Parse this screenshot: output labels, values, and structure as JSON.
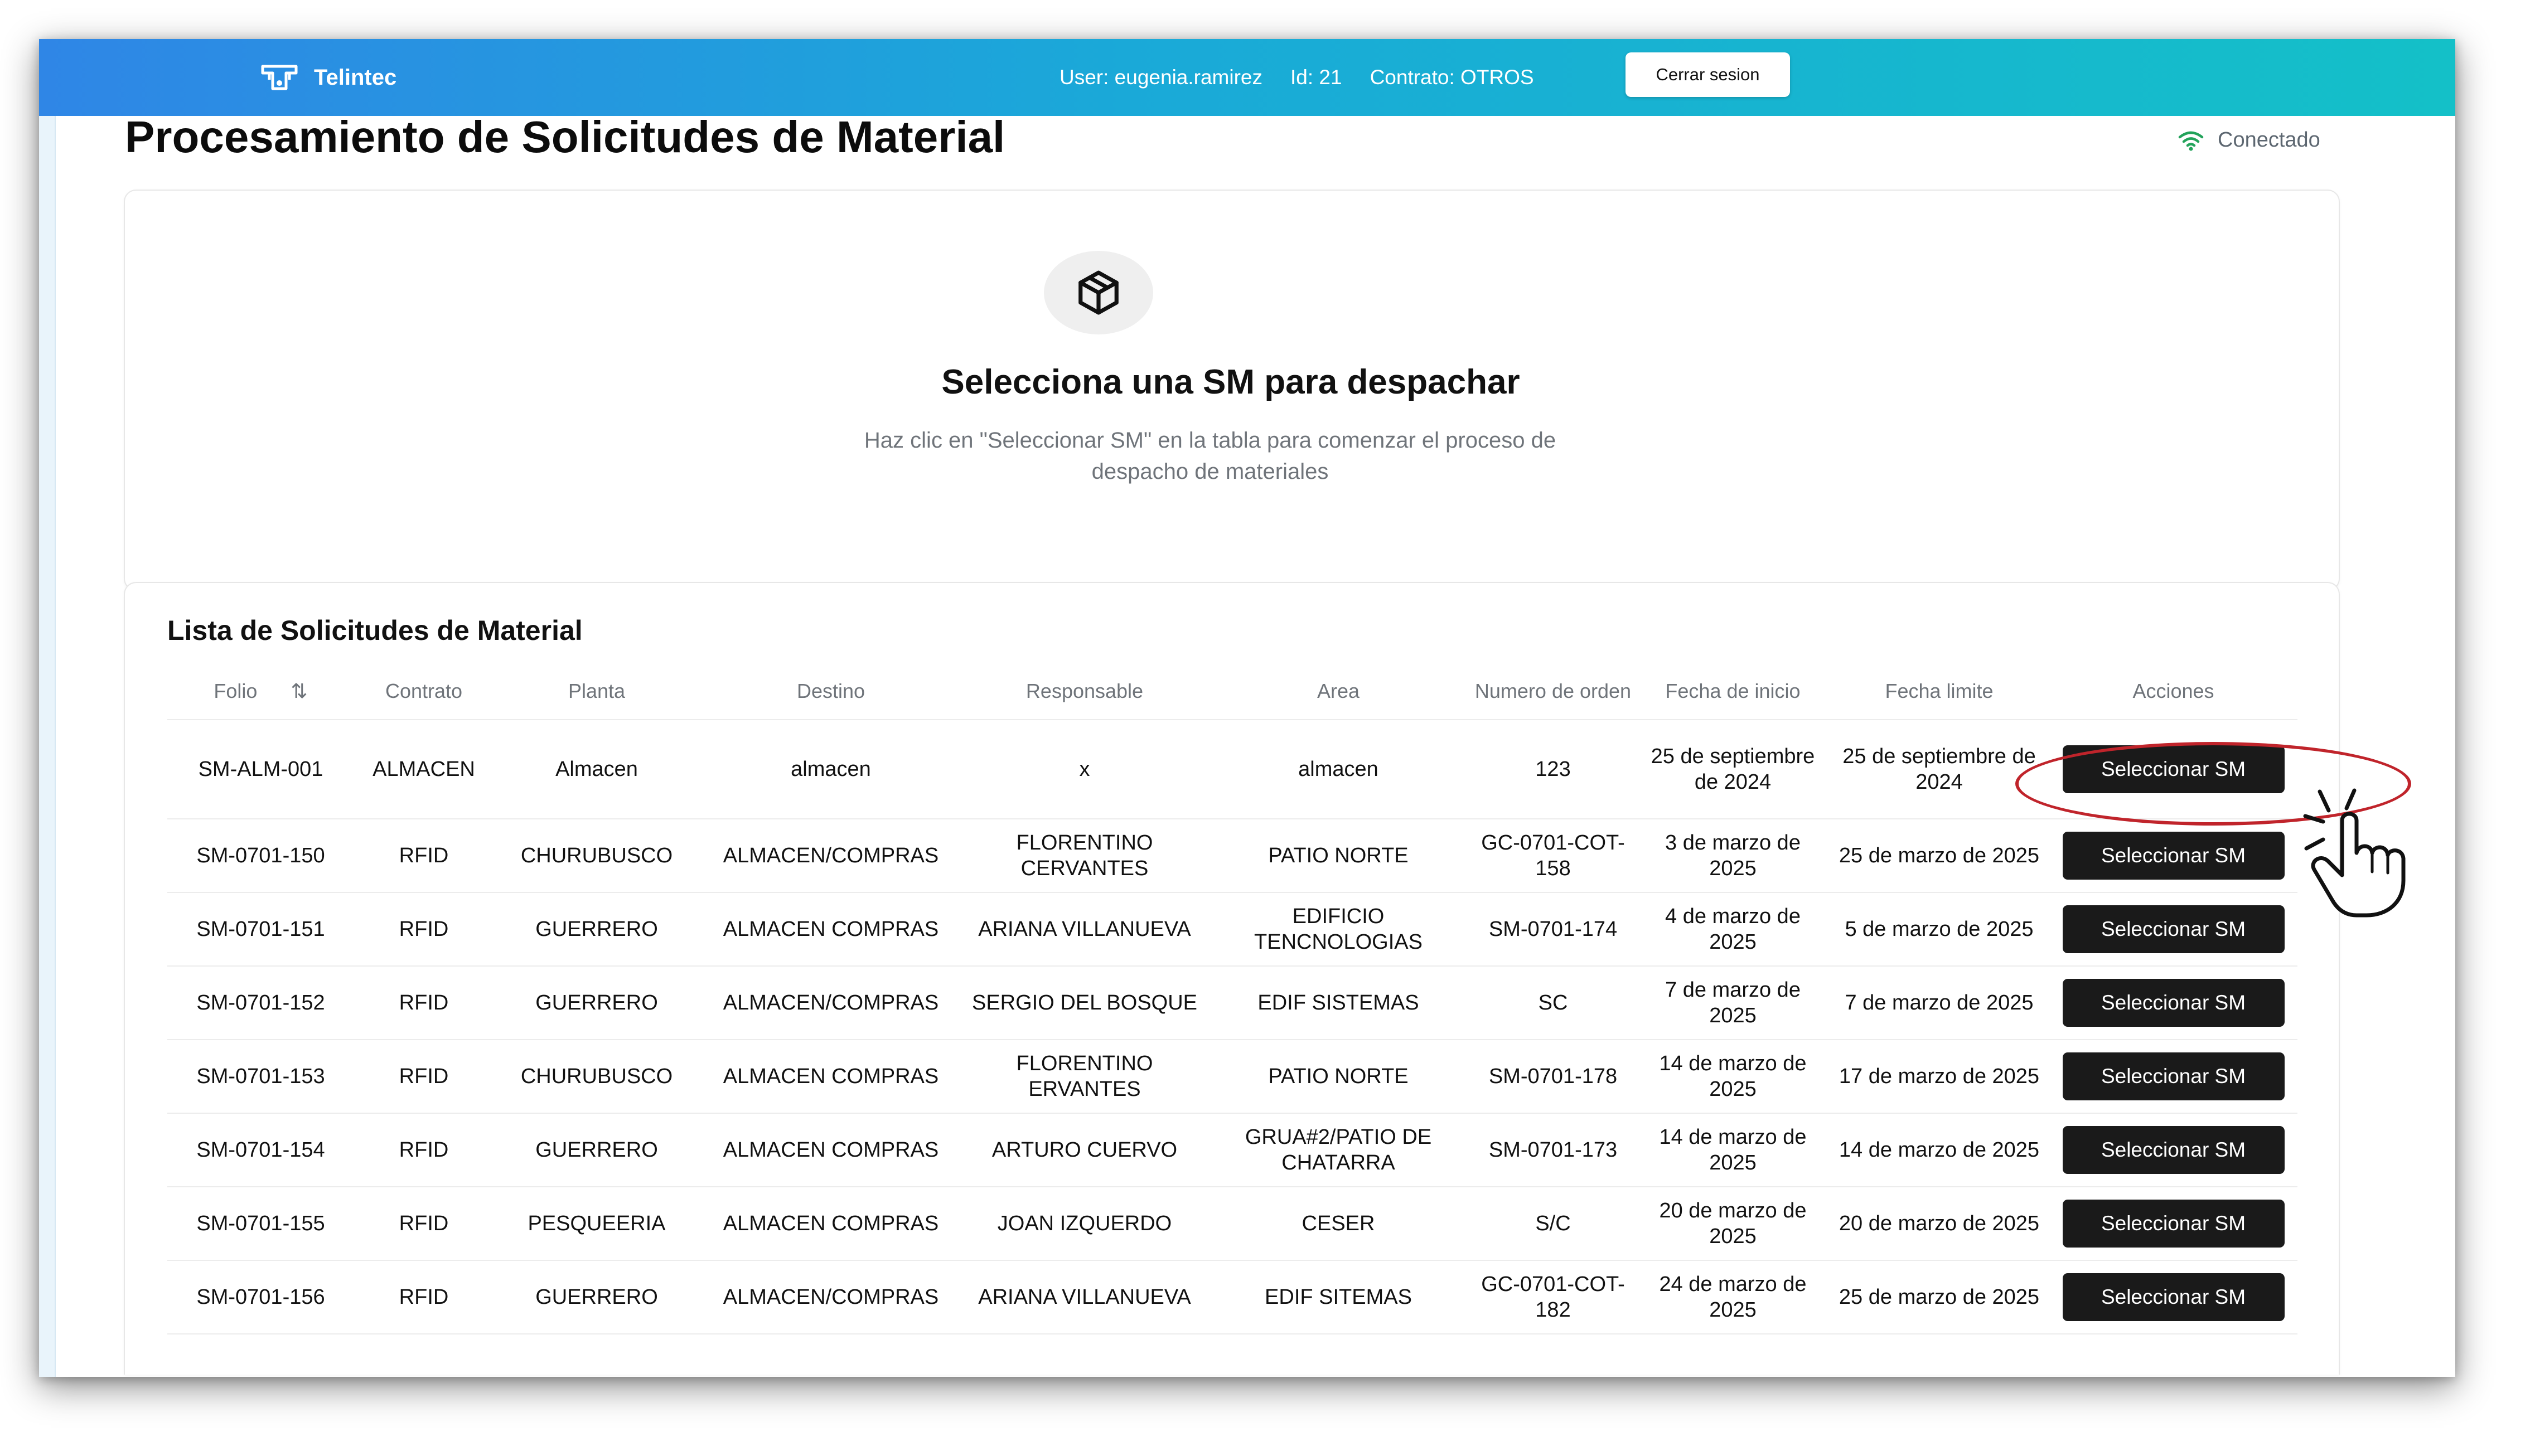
{
  "app": {
    "brand_name": "Telintec",
    "user_label": "User: eugenia.ramirez",
    "id_label": "Id: 21",
    "contract_label": "Contrato: OTROS",
    "logout_label": "Cerrar sesion"
  },
  "page": {
    "title": "Procesamiento de Solicitudes de Material",
    "connection_status": "Conectado"
  },
  "empty_state": {
    "icon": "box-icon",
    "title": "Selecciona una SM para despachar",
    "description": "Haz clic en \"Seleccionar SM\" en la tabla para comenzar el proceso de despacho de materiales"
  },
  "list": {
    "title": "Lista de Solicitudes de Material",
    "columns": [
      "Folio",
      "Contrato",
      "Planta",
      "Destino",
      "Responsable",
      "Area",
      "Numero de orden",
      "Fecha de inicio",
      "Fecha limite",
      "Acciones"
    ],
    "action_label": "Seleccionar SM",
    "rows": [
      [
        "SM-ALM-001",
        "ALMACEN",
        "Almacen",
        "almacen",
        "x",
        "almacen",
        "123",
        "25 de septiembre de 2024",
        "25 de septiembre de 2024"
      ],
      [
        "SM-0701-150",
        "RFID",
        "CHURUBUSCO",
        "ALMACEN/COMPRAS",
        "FLORENTINO CERVANTES",
        "PATIO NORTE",
        "GC-0701-COT-158",
        "3 de marzo de 2025",
        "25 de marzo de 2025"
      ],
      [
        "SM-0701-151",
        "RFID",
        "GUERRERO",
        "ALMACEN COMPRAS",
        "ARIANA VILLANUEVA",
        "EDIFICIO TENCNOLOGIAS",
        "SM-0701-174",
        "4 de marzo de 2025",
        "5 de marzo de 2025"
      ],
      [
        "SM-0701-152",
        "RFID",
        "GUERRERO",
        "ALMACEN/COMPRAS",
        "SERGIO DEL BOSQUE",
        "EDIF SISTEMAS",
        "SC",
        "7 de marzo de 2025",
        "7 de marzo de 2025"
      ],
      [
        "SM-0701-153",
        "RFID",
        "CHURUBUSCO",
        "ALMACEN COMPRAS",
        "FLORENTINO ERVANTES",
        "PATIO NORTE",
        "SM-0701-178",
        "14 de marzo de 2025",
        "17 de marzo de 2025"
      ],
      [
        "SM-0701-154",
        "RFID",
        "GUERRERO",
        "ALMACEN COMPRAS",
        "ARTURO CUERVO",
        "GRUA#2/PATIO DE CHATARRA",
        "SM-0701-173",
        "14 de marzo de 2025",
        "14 de marzo de 2025"
      ],
      [
        "SM-0701-155",
        "RFID",
        "PESQUEERIA",
        "ALMACEN COMPRAS",
        "JOAN IZQUERDO",
        "CESER",
        "S/C",
        "20 de marzo de 2025",
        "20 de marzo de 2025"
      ],
      [
        "SM-0701-156",
        "RFID",
        "GUERRERO",
        "ALMACEN/COMPRAS",
        "ARIANA VILLANUEVA",
        "EDIF SITEMAS",
        "GC-0701-COT-182",
        "24 de marzo de 2025",
        "25 de marzo de 2025"
      ]
    ]
  },
  "colors": {
    "header_gradient_start": "#2f86e6",
    "header_gradient_end": "#14c0c8",
    "button_dark": "#1a1a1a",
    "status_icon": "#22a35a",
    "annotation_red": "#c0242b"
  }
}
